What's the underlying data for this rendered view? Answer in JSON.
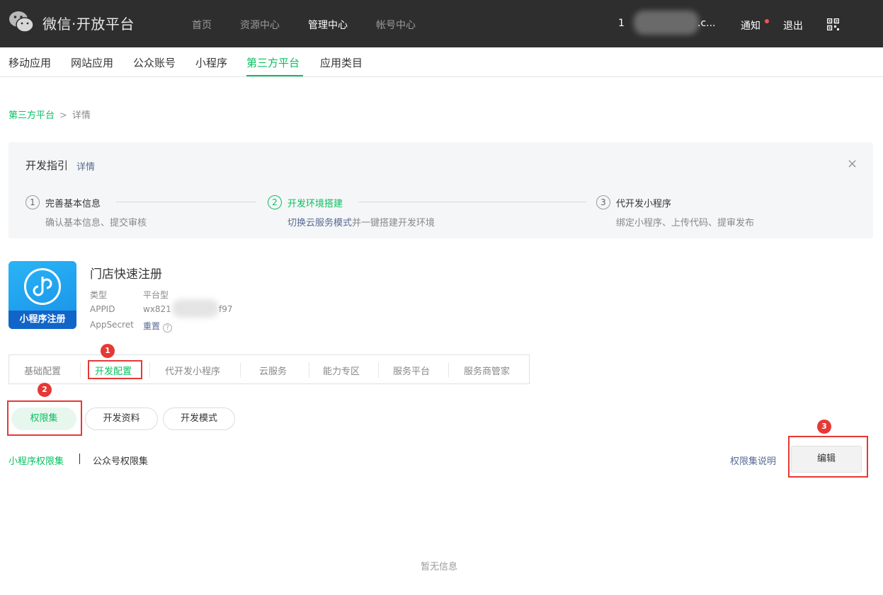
{
  "header": {
    "brand": "微信·开放平台",
    "nav": [
      {
        "label": "首页",
        "active": false
      },
      {
        "label": "资源中心",
        "active": false
      },
      {
        "label": "管理中心",
        "active": true
      },
      {
        "label": "帐号中心",
        "active": false
      }
    ],
    "user_prefix": "1",
    "user_suffix": ".c...",
    "notify_label": "通知",
    "logout_label": "退出",
    "qr_icon": "qr-code-icon"
  },
  "subnav": {
    "items": [
      {
        "label": "移动应用",
        "active": false
      },
      {
        "label": "网站应用",
        "active": false
      },
      {
        "label": "公众账号",
        "active": false
      },
      {
        "label": "小程序",
        "active": false
      },
      {
        "label": "第三方平台",
        "active": true
      },
      {
        "label": "应用类目",
        "active": false
      }
    ]
  },
  "breadcrumb": {
    "parent": "第三方平台",
    "separator": ">",
    "current": "详情"
  },
  "guide": {
    "title": "开发指引",
    "detail_link": "详情",
    "close_icon": "×",
    "steps": [
      {
        "num": "1",
        "title": "完善基本信息",
        "desc": "确认基本信息、提交审核",
        "desc_link": "",
        "active": false
      },
      {
        "num": "2",
        "title": "开发环境搭建",
        "desc": "并一键搭建开发环境",
        "desc_link": "切换云服务模式",
        "active": true
      },
      {
        "num": "3",
        "title": "代开发小程序",
        "desc": "绑定小程序、上传代码、提审发布",
        "desc_link": "",
        "active": false
      }
    ]
  },
  "app": {
    "icon_label": "小程序注册",
    "name": "门店快速注册",
    "type_label": "类型",
    "type_value": "平台型",
    "appid_label": "APPID",
    "appid_prefix": "wx821",
    "appid_suffix": "f97",
    "secret_label": "AppSecret",
    "secret_action": "重置",
    "help_icon": "?"
  },
  "tabs": [
    {
      "label": "基础配置",
      "active": false
    },
    {
      "label": "开发配置",
      "active": true
    },
    {
      "label": "代开发小程序",
      "active": false
    },
    {
      "label": "云服务",
      "active": false
    },
    {
      "label": "能力专区",
      "active": false
    },
    {
      "label": "服务平台",
      "active": false
    },
    {
      "label": "服务商管家",
      "active": false
    }
  ],
  "pills": [
    {
      "label": "权限集",
      "active": true
    },
    {
      "label": "开发资料",
      "active": false
    },
    {
      "label": "开发模式",
      "active": false
    }
  ],
  "permissions": {
    "mini_program": "小程序权限集",
    "official_account": "公众号权限集",
    "help_link": "权限集说明",
    "edit_button": "编辑"
  },
  "annotations": [
    "1",
    "2",
    "3"
  ],
  "empty_text": "暂无信息",
  "colors": {
    "accent": "#07c160",
    "link": "#576b95",
    "annotation": "#e53935",
    "topbar": "#2e2e2e"
  }
}
